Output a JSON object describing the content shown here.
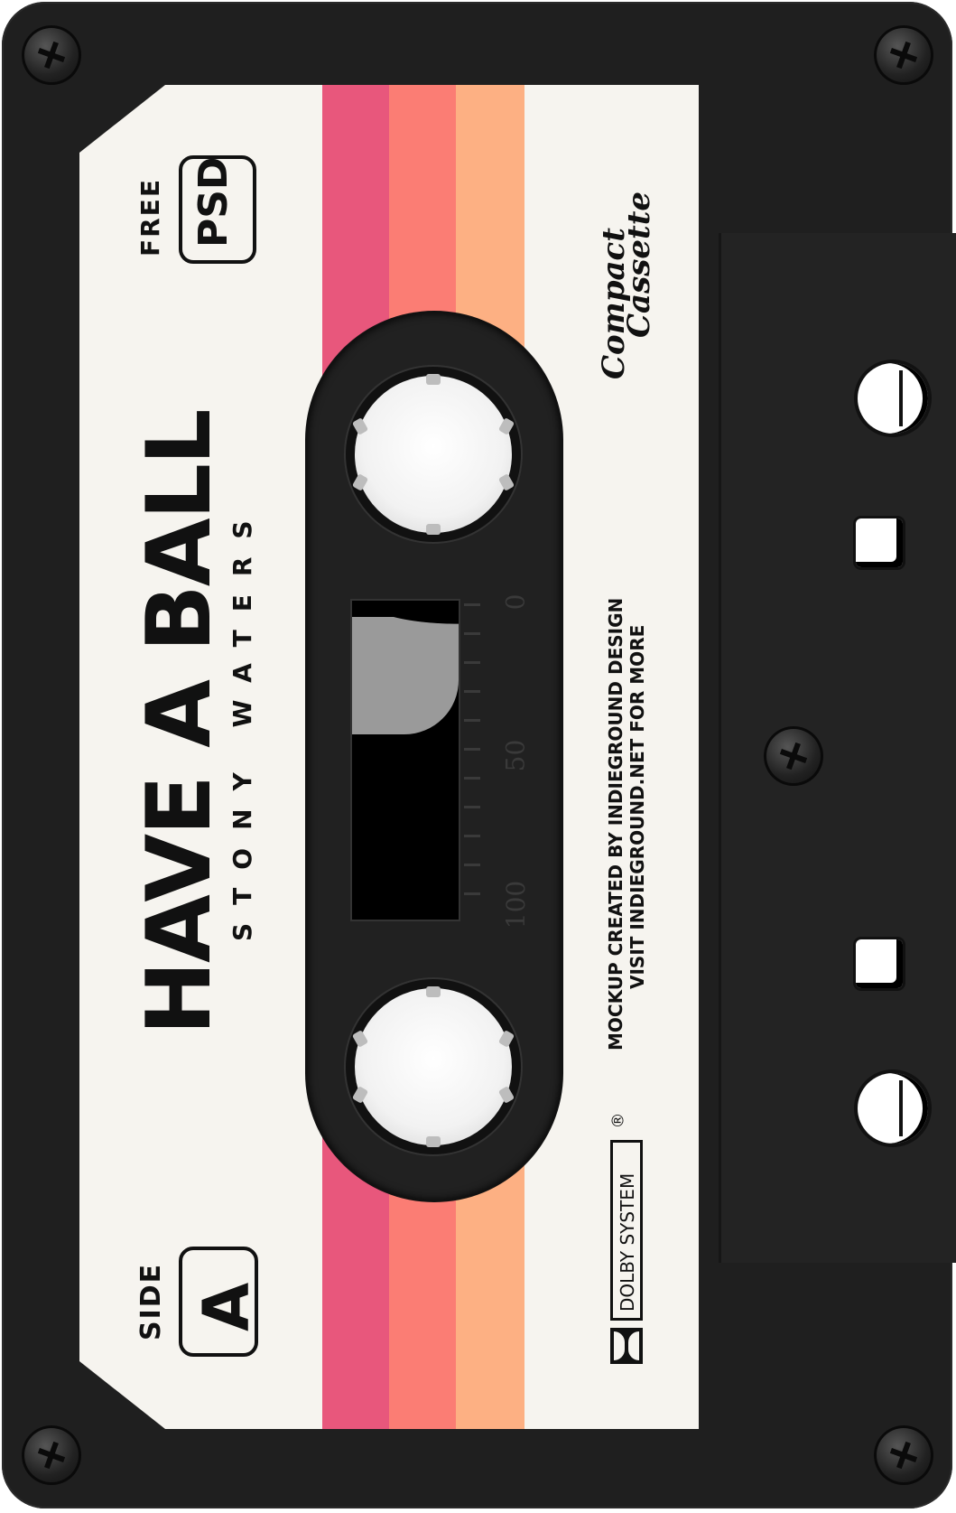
{
  "colors": {
    "body": "#1f1f1f",
    "label": "#f6f4ef",
    "stripe_1": "#e8577c",
    "stripe_2": "#fb7d74",
    "stripe_3": "#fdb083"
  },
  "label": {
    "title": "HAVE A BALL",
    "artist": "STONY WATERS",
    "free_text": "FREE",
    "badge_text": "PSD",
    "side_text": "SIDE",
    "side_letter": "A",
    "brand_line1": "Compact",
    "brand_line2": "Cassette",
    "credit_line1": "MOCKUP CREATED BY INDIEGROUND DESIGN",
    "credit_line2": "VISIT INDIEGROUND.NET FOR MORE",
    "dolby_text": "DOLBY SYSTEM",
    "registered": "®"
  },
  "scale": {
    "mark_0": "0",
    "mark_50": "50",
    "mark_100": "100"
  },
  "icons": {
    "screw": "screw-icon",
    "dolby": "dolby-logo-icon"
  }
}
